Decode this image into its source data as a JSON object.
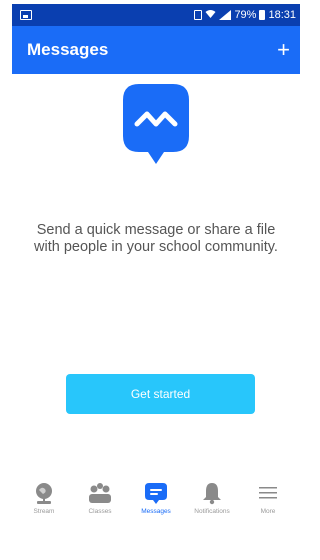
{
  "status_bar": {
    "battery_percent": "79%",
    "time": "18:31"
  },
  "appbar": {
    "title": "Messages",
    "add_symbol": "+"
  },
  "empty_state": {
    "illustration": "message-bubble-icon",
    "message": "Send a quick message or share a file with people in your school community."
  },
  "cta": {
    "label": "Get started"
  },
  "bottom_nav": {
    "items": [
      {
        "label": "Stream",
        "icon": "globe-icon",
        "active": false
      },
      {
        "label": "Classes",
        "icon": "classes-icon",
        "active": false
      },
      {
        "label": "Messages",
        "icon": "messages-icon",
        "active": true
      },
      {
        "label": "Notifications",
        "icon": "bell-icon",
        "active": false
      },
      {
        "label": "More",
        "icon": "menu-icon",
        "active": false
      }
    ]
  },
  "colors": {
    "status_bar": "#0a3fb0",
    "brand_blue": "#1a6cf7",
    "cta_cyan": "#28c6fb",
    "inactive_gray": "#9a9a9a"
  }
}
